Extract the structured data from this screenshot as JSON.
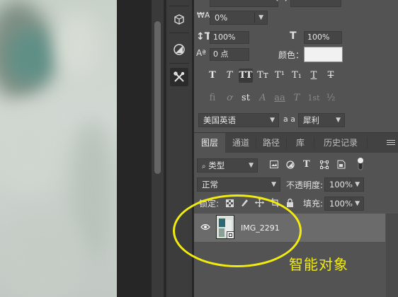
{
  "character_panel": {
    "tracking_value": "0%",
    "vertical_scale": "100%",
    "horizontal_scale": "100%",
    "baseline_shift": "0 点",
    "color_label": "颜色：",
    "color_value": "#ffffff",
    "type_buttons": [
      "T",
      "T",
      "TT",
      "Tт",
      "T¹",
      "T₁",
      "T",
      "T"
    ],
    "opentype_buttons": [
      "fi",
      "ơ",
      "st",
      "A",
      "aa",
      "T",
      "1st",
      "½"
    ],
    "language": "美国英语",
    "aa_icon_label": "a a",
    "antialias": "犀利"
  },
  "layers_panel": {
    "tabs": [
      "图层",
      "通道",
      "路径",
      "库",
      "历史记录"
    ],
    "active_tab": "图层",
    "filter_kind": "类型",
    "blend_mode": "正常",
    "opacity_label": "不透明度:",
    "opacity_value": "100%",
    "lock_label": "锁定:",
    "fill_label": "填充:",
    "fill_value": "100%",
    "layers": [
      {
        "name": "IMG_2291",
        "visible": true,
        "type": "smart-object",
        "selected": true
      }
    ]
  },
  "annotation": {
    "text": "智能对象",
    "color": "#f1ec0e"
  },
  "colors": {
    "panel_bg": "#535353",
    "dock_bg": "#3c3c3c",
    "selected_layer_bg": "#6b6b6b",
    "annotation_yellow": "#f1ec0e"
  }
}
